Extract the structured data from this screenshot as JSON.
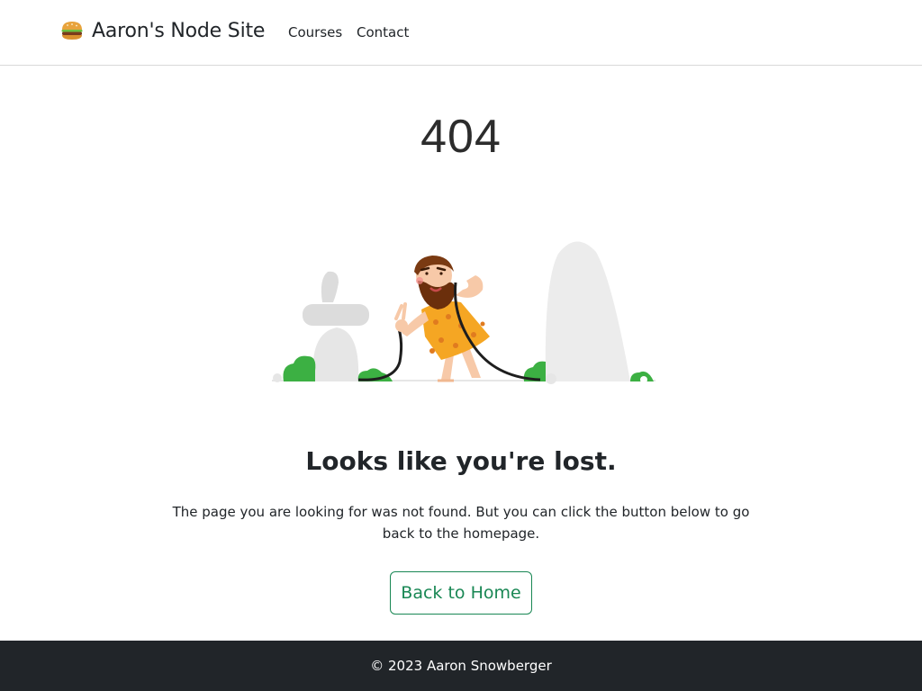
{
  "navbar": {
    "brand_icon": "hamburger-emoji-icon",
    "brand": "Aaron's Node Site",
    "links": [
      {
        "label": "Courses"
      },
      {
        "label": "Contact"
      }
    ]
  },
  "main": {
    "code": "404",
    "illustration": "caveman-unplugged-cable-illustration",
    "headline": "Looks like you're lost.",
    "description": "The page you are looking for was not found. But you can click the button below to go back to the homepage.",
    "button_label": "Back to Home"
  },
  "footer": {
    "text": "© 2023 Aaron Snowberger"
  },
  "colors": {
    "accent": "#198754",
    "footer_bg": "#212529",
    "plant_green": "#3cb043",
    "rock_gray": "#e6e6e6",
    "tunic_orange": "#f5a623"
  }
}
